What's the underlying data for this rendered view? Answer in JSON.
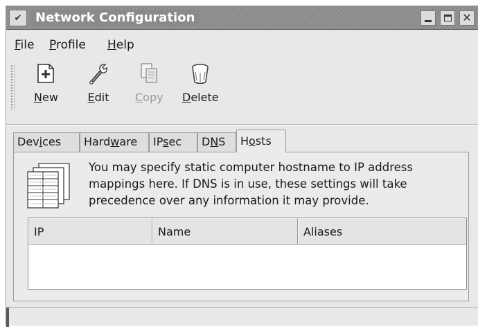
{
  "window": {
    "title": "Network Configuration"
  },
  "menubar": [
    {
      "label": "File",
      "mnemonic": "F",
      "rest": "ile"
    },
    {
      "label": "Profile",
      "mnemonic": "P",
      "rest": "rofile"
    },
    {
      "label": "Help",
      "mnemonic": "H",
      "rest": "elp"
    }
  ],
  "toolbar": {
    "new": {
      "mnemonic": "N",
      "rest": "ew",
      "icon": "new-icon"
    },
    "edit": {
      "mnemonic": "E",
      "rest": "dit",
      "icon": "wrench-icon"
    },
    "copy": {
      "mnemonic": "C",
      "rest": "opy",
      "icon": "copy-icon",
      "enabled": false
    },
    "delete": {
      "mnemonic": "D",
      "rest": "elete",
      "icon": "trash-icon"
    }
  },
  "tabs": {
    "devices": {
      "pre": "Dev",
      "mnemonic": "i",
      "post": "ces"
    },
    "hardware": {
      "pre": "Hard",
      "mnemonic": "w",
      "post": "are"
    },
    "ipsec": {
      "pre": "IP",
      "mnemonic": "s",
      "post": "ec"
    },
    "dns": {
      "pre": "D",
      "mnemonic": "N",
      "post": "S"
    },
    "hosts": {
      "pre": "H",
      "mnemonic": "o",
      "post": "sts",
      "selected": true
    }
  },
  "hosts_page": {
    "info_lines": [
      "You may specify static computer hostname to IP address",
      "mappings here.  If DNS is in use, these settings will take",
      "precedence over any information it may provide."
    ],
    "columns": [
      "IP",
      "Name",
      "Aliases"
    ],
    "rows": []
  },
  "colors": {
    "titlebar": "#8a8a8a",
    "window_bg": "#e8e8e8",
    "list_bg": "#ffffff"
  }
}
